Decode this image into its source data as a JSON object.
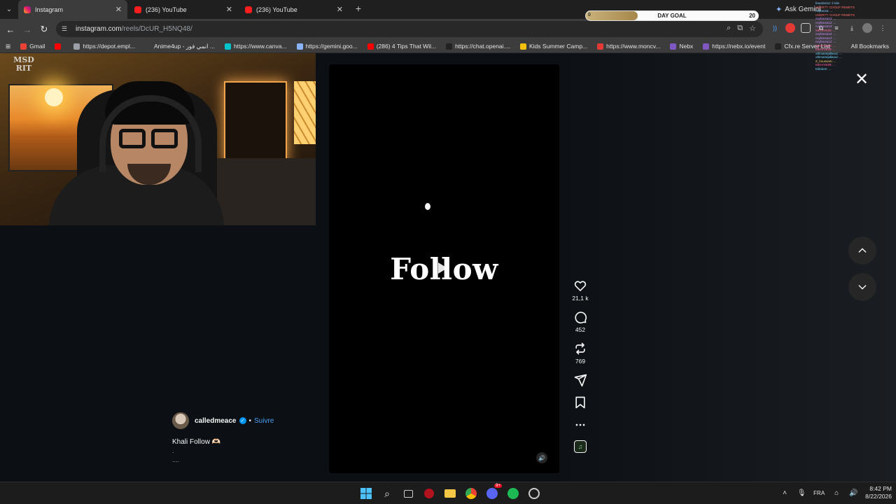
{
  "browser": {
    "tabs": [
      {
        "label": "Instagram",
        "favicon": "instagram-icon",
        "active": true
      },
      {
        "label": "(236) YouTube",
        "favicon": "youtube-icon",
        "active": false
      },
      {
        "label": "(236) YouTube",
        "favicon": "youtube-icon",
        "active": false
      }
    ],
    "new_tab": "+",
    "url_host": "instagram.com",
    "url_path": "/reels/DcUR_H5NQ48/",
    "ask_gemini": "Ask Gemini",
    "all_bookmarks": "All Bookmarks",
    "bookmarks": [
      {
        "label": "Gmail",
        "color": "#ea4335"
      },
      {
        "label": "",
        "color": "#ff0000"
      },
      {
        "label": "https://depot.empl...",
        "color": "#9aa0a6"
      },
      {
        "label": "Anime4up - انمي فور ...",
        "color": "#3c3c3c"
      },
      {
        "label": "https://www.canva...",
        "color": "#00c4cc"
      },
      {
        "label": "https://gemini.goo...",
        "color": "#8ab4f8"
      },
      {
        "label": "(286) 4 Tips That Wil...",
        "color": "#ff0000"
      },
      {
        "label": "https://chat.openai....",
        "color": "#222222"
      },
      {
        "label": "Kids Summer Camp...",
        "color": "#f4c20d"
      },
      {
        "label": "https://www.moncv...",
        "color": "#e53935"
      },
      {
        "label": "Nebx",
        "color": "#7e57c2"
      },
      {
        "label": "https://nebx.io/event",
        "color": "#7e57c2"
      },
      {
        "label": "Cfx.re Server List",
        "color": "#222222"
      }
    ]
  },
  "stream_overlay": {
    "day_goal": {
      "label": "DAY GOAL",
      "current": "0",
      "target": "20",
      "progress": 0.3
    },
    "chat_lines": [
      "brandonsz: k lole",
      "USER77: CHOUF REMETS",
      "nvyfan4a: ...",
      "USER77: CHOUF REMETS",
      "nvyfan4a12: ...",
      "nvyfan4a12: ...",
      "nvyfan4a12: ...",
      "MEHANI89: ...",
      "nvyfan4a12: ...",
      "nvyfan4a12: ...",
      "nvyfan4a12: ...",
      "MEHANI89: ...",
      "MEHANI89: ...",
      "othmanejallaoui: ...",
      "othmanejallaoui: ...",
      "Z_houssam: ...",
      "MEHANI89: ...",
      "Ktikdom: ..."
    ]
  },
  "reel": {
    "overlay_word": "Follow",
    "username": "calledmeace",
    "follow_label": "Suivre",
    "caption_line": "Khali Follow 🫶🏻",
    "caption_dot": ".",
    "caption_more": "....",
    "likes": "21,1 k",
    "comments": "452",
    "reposts": "769"
  },
  "taskbar": {
    "language": "FRA",
    "time": "8:42 PM",
    "date": "8/22/2026",
    "discord_badge": "9+"
  },
  "colors": {
    "page_bg": "#0c1014",
    "link_blue": "#4a9ef5",
    "verified_blue": "#0095f6"
  }
}
